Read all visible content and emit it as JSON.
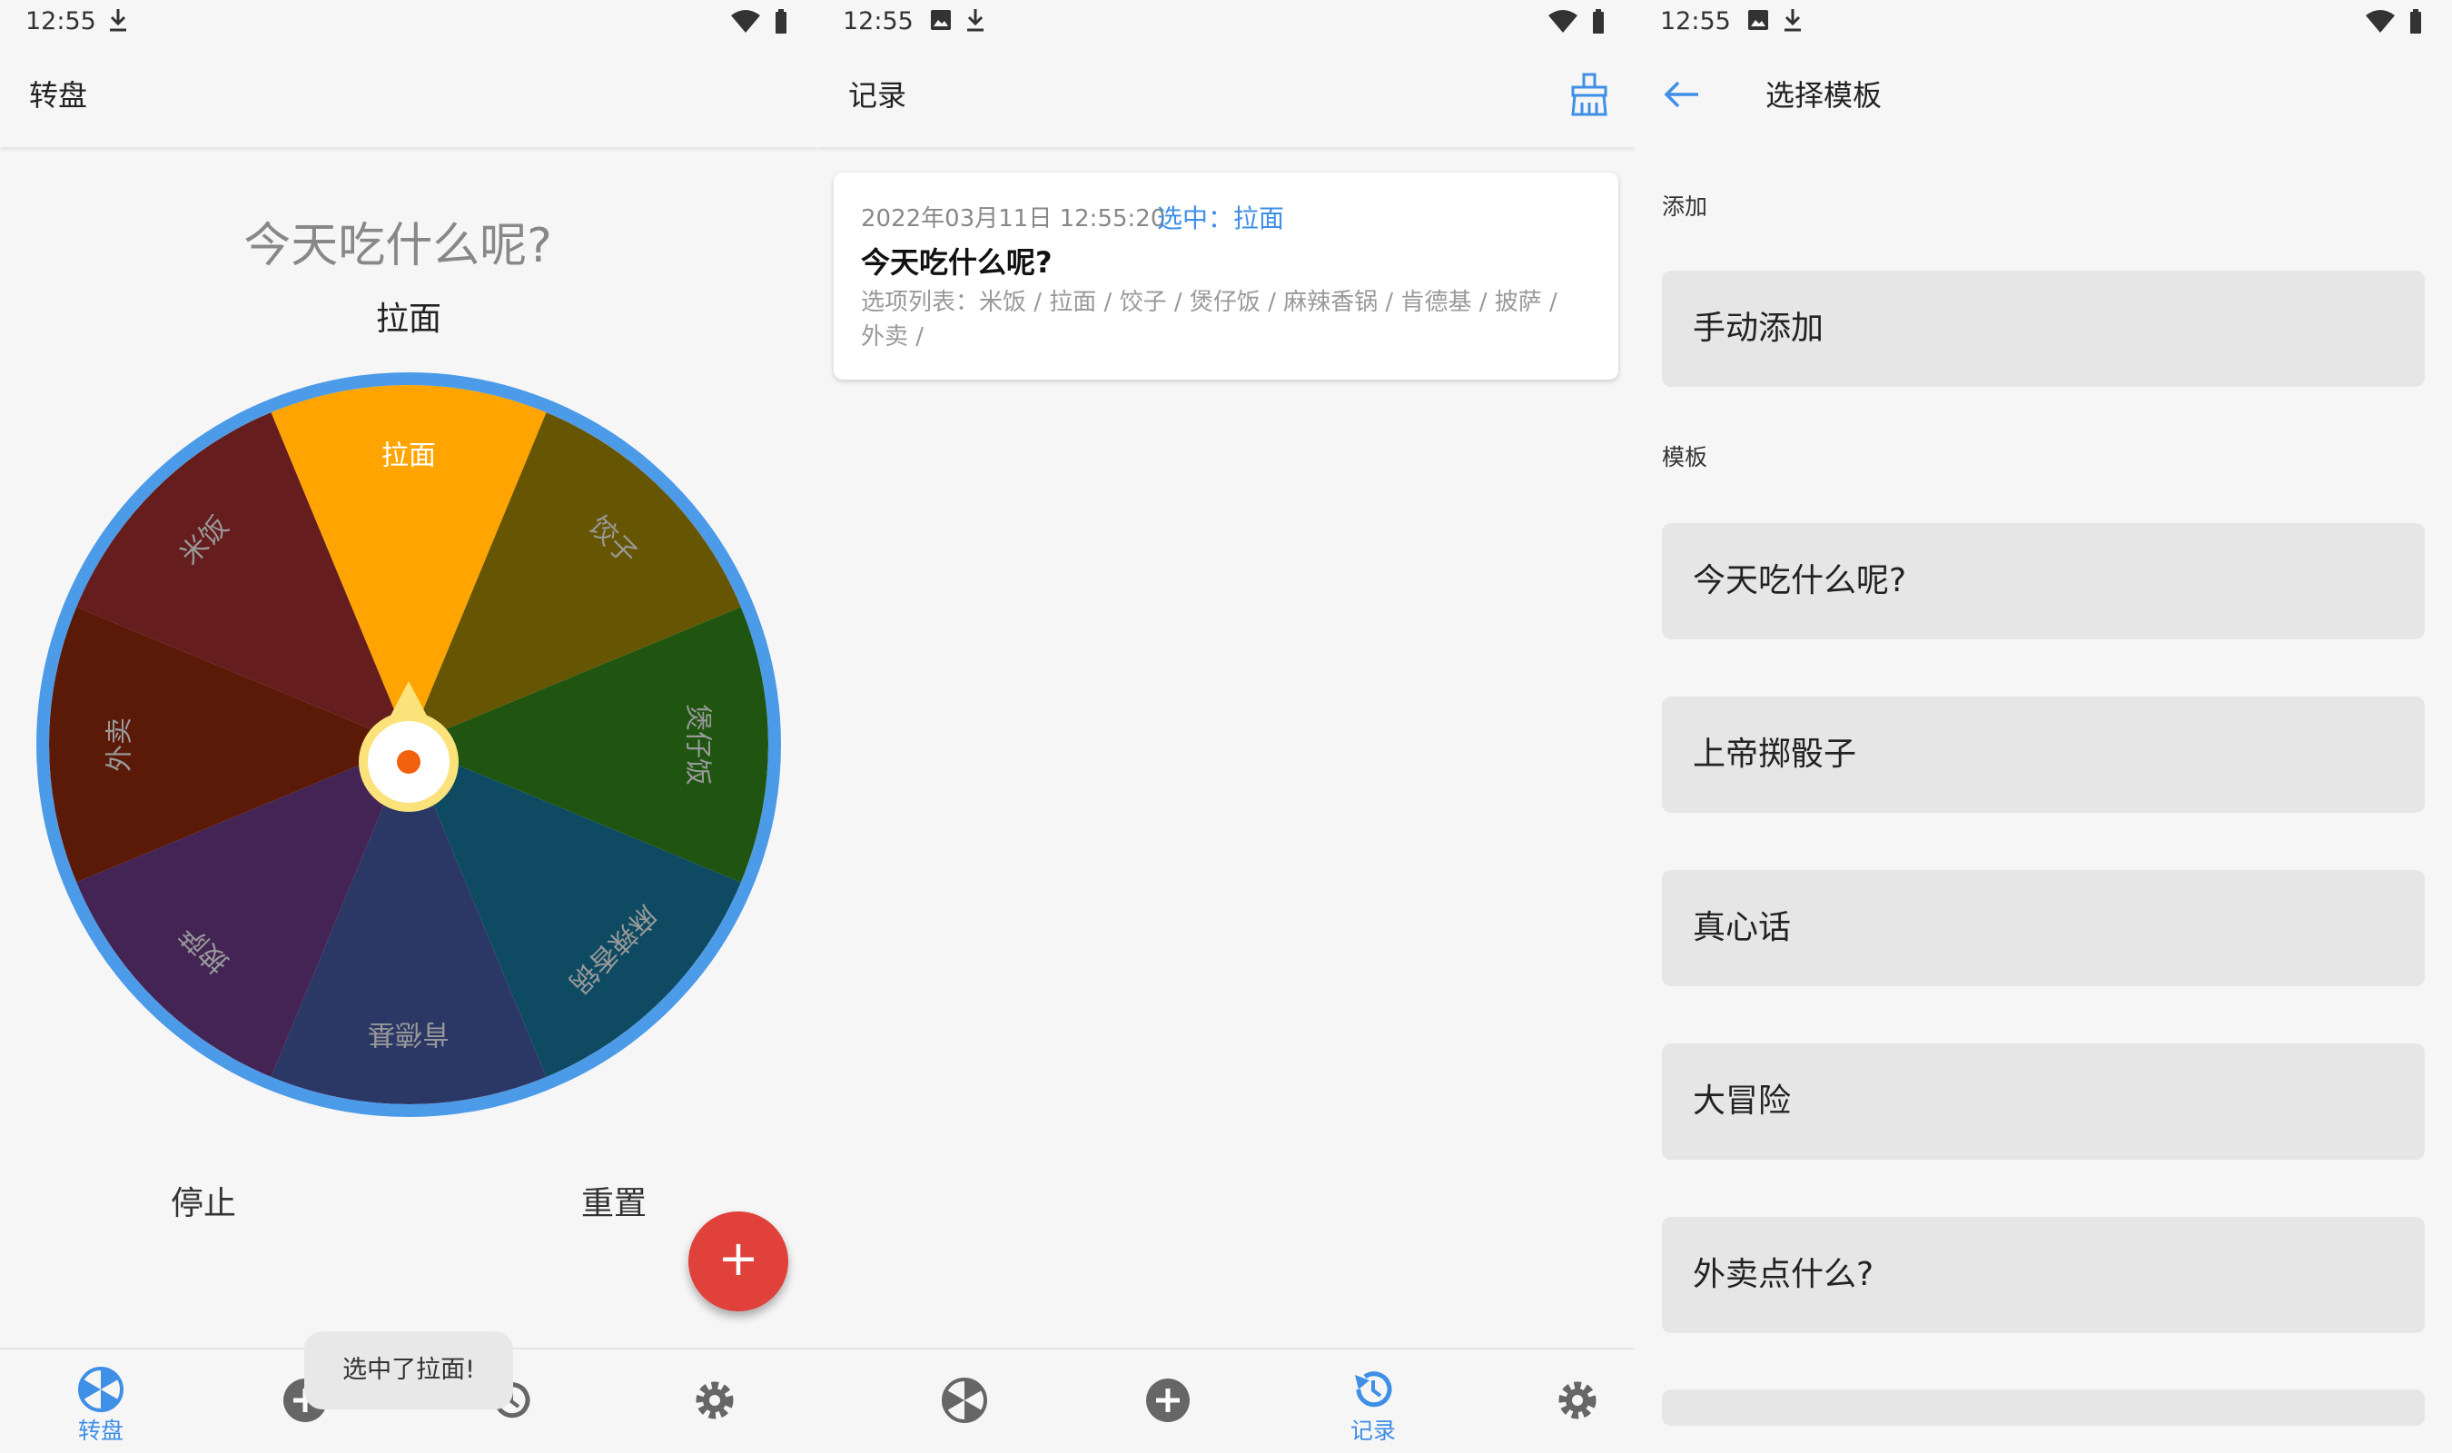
{
  "status": {
    "time": "12:55"
  },
  "wheel_screen": {
    "title": "转盘",
    "question": "今天吃什么呢?",
    "result": "拉面",
    "stop_label": "停止",
    "reset_label": "重置",
    "fab_label": "+",
    "toast": "选中了拉面!",
    "segments": [
      {
        "label": "拉面",
        "color": "#ffa400"
      },
      {
        "label": "饺子",
        "color": "#665603"
      },
      {
        "label": "煲仔饭",
        "color": "#1f5510"
      },
      {
        "label": "麻辣香锅",
        "color": "#0e4a62"
      },
      {
        "label": "肯德基",
        "color": "#2b3865"
      },
      {
        "label": "披萨",
        "color": "#432454"
      },
      {
        "label": "外卖",
        "color": "#5a1a07"
      },
      {
        "label": "米饭",
        "color": "#651d1e"
      }
    ],
    "ring_color": "#4c9be8",
    "nav": {
      "wheel_label": "转盘"
    }
  },
  "record_screen": {
    "title": "记录",
    "record": {
      "time": "2022年03月11日 12:55:20",
      "selected": "选中：拉面",
      "title": "今天吃什么呢?",
      "options": "选项列表：米饭 / 拉面 / 饺子 / 煲仔饭 / 麻辣香锅 / 肯德基 / 披萨 / 外卖 /"
    },
    "nav": {
      "record_label": "记录"
    }
  },
  "template_screen": {
    "title": "选择模板",
    "add_section": "添加",
    "manual_add": "手动添加",
    "template_section": "模板",
    "templates": [
      "今天吃什么呢?",
      "上帝掷骰子",
      "真心话",
      "大冒险",
      "外卖点什么?"
    ]
  },
  "accent_color": "#3f8fe6"
}
